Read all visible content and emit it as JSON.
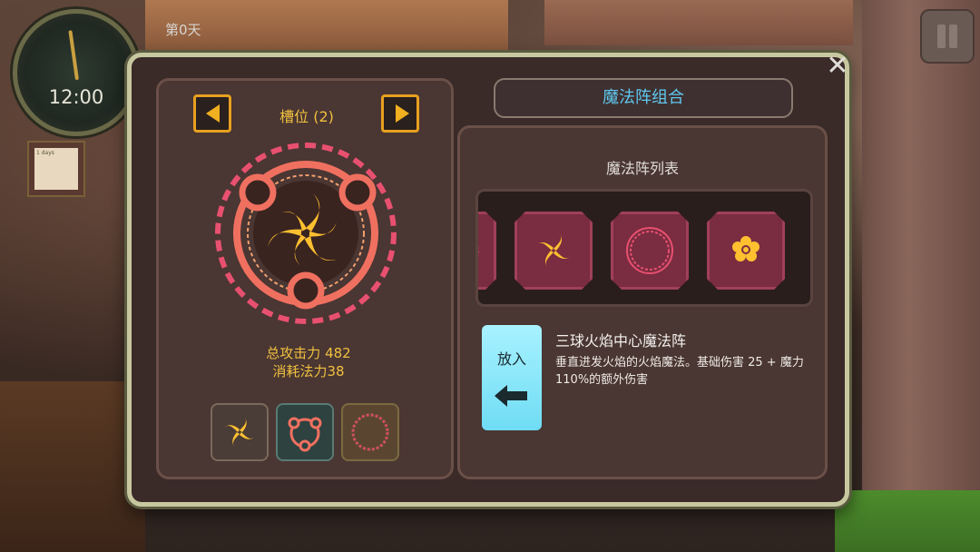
{
  "hud": {
    "clock_time": "12:00",
    "day_label": "第0天",
    "note_text": "1 days"
  },
  "dialog": {
    "title": "魔法阵组合",
    "close_icon": "close-icon"
  },
  "slot_selector": {
    "label": "槽位 (2)",
    "prev_icon": "arrow-left-icon",
    "next_icon": "arrow-right-icon"
  },
  "stats": {
    "attack": "总攻击力 482",
    "mana_cost": "消耗法力38"
  },
  "equipped_slots": [
    {
      "icon": "pinwheel-flame-icon"
    },
    {
      "icon": "triple-ring-frame-icon"
    },
    {
      "icon": "dashed-circle-icon"
    }
  ],
  "circle_list": {
    "title": "魔法阵列表",
    "items": [
      {
        "icon": "partial-circle-icon"
      },
      {
        "icon": "pinwheel-flame-icon"
      },
      {
        "icon": "dashed-circle-icon"
      },
      {
        "icon": "flower-icon"
      }
    ]
  },
  "put_button": {
    "label": "放入",
    "icon": "arrow-left-icon"
  },
  "selected": {
    "name": "三球火焰中心魔法阵",
    "description": "垂直进发火焰的火焰魔法。基础伤害 25 + 魔力110%的额外伤害"
  },
  "colors": {
    "accent_gold": "#f0c040",
    "title_blue": "#5fc8f0",
    "tile_bg": "#7a2c40",
    "put_button_cyan": "#8ee8f8"
  }
}
